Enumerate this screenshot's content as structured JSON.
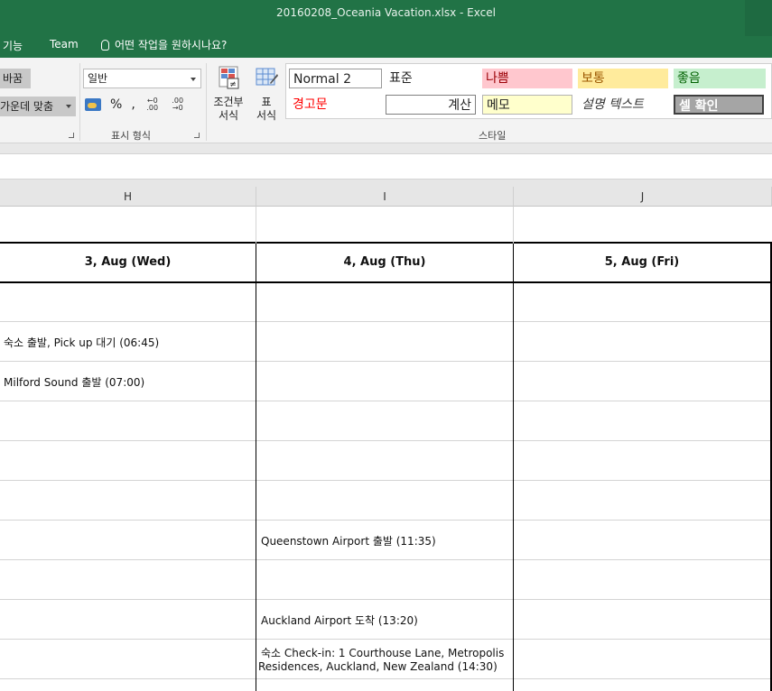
{
  "window": {
    "title": "20160208_Oceania Vacation.xlsx - Excel"
  },
  "ribbon_tabs": [
    "기능",
    "Team"
  ],
  "tell_me": "어떤 작업을 원하시나요?",
  "alignment": {
    "wrap_label": "바꿈",
    "merge_label": "가운데 맞춤"
  },
  "number": {
    "format_value": "일반",
    "percent": "%",
    "comma": ",",
    "group_label": "표시 형식"
  },
  "styles": {
    "cf_label_1": "조건부",
    "cf_label_2": "서식",
    "table_label_1": "표",
    "table_label_2": "서식",
    "group_label": "스타일",
    "items": [
      {
        "name": "Normal 2",
        "bg": "#ffffff",
        "color": "#222222"
      },
      {
        "name": "표준",
        "bg": "#ffffff",
        "color": "#222222"
      },
      {
        "name": "나쁨",
        "bg": "#ffc7ce",
        "color": "#9c0006"
      },
      {
        "name": "보통",
        "bg": "#ffeb9c",
        "color": "#9c5700"
      },
      {
        "name": "좋음",
        "bg": "#c6efce",
        "color": "#006100"
      },
      {
        "name": "경고문",
        "bg": "#ffffff",
        "color": "#ff0000"
      },
      {
        "name": "계산",
        "bg": "#ffffff",
        "color": "#222222"
      },
      {
        "name": "메모",
        "bg": "#ffffcc",
        "color": "#222222"
      },
      {
        "name": "설명 텍스트",
        "bg": "#ffffff",
        "color": "#333333"
      },
      {
        "name": "셀 확인",
        "bg": "#a5a5a5",
        "color": "#ffffff"
      }
    ]
  },
  "columns": [
    "H",
    "I",
    "J"
  ],
  "date_headers": [
    "3, Aug (Wed)",
    "4, Aug (Thu)",
    "5, Aug (Fri)"
  ],
  "cells": {
    "h_row2": "숙소 출발, Pick up 대기 (06:45)",
    "h_row3": "Milford Sound 출발 (07:00)",
    "i_row7": "Queenstown Airport 출발 (11:35)",
    "i_row9": "Auckland Airport 도착 (13:20)",
    "i_row10_line1": "숙소 Check-in: 1 Courthouse Lane, Metropolis",
    "i_row10_line2": "Residences, Auckland, New Zealand (14:30)"
  },
  "colors": {
    "excel_green": "#217346"
  }
}
